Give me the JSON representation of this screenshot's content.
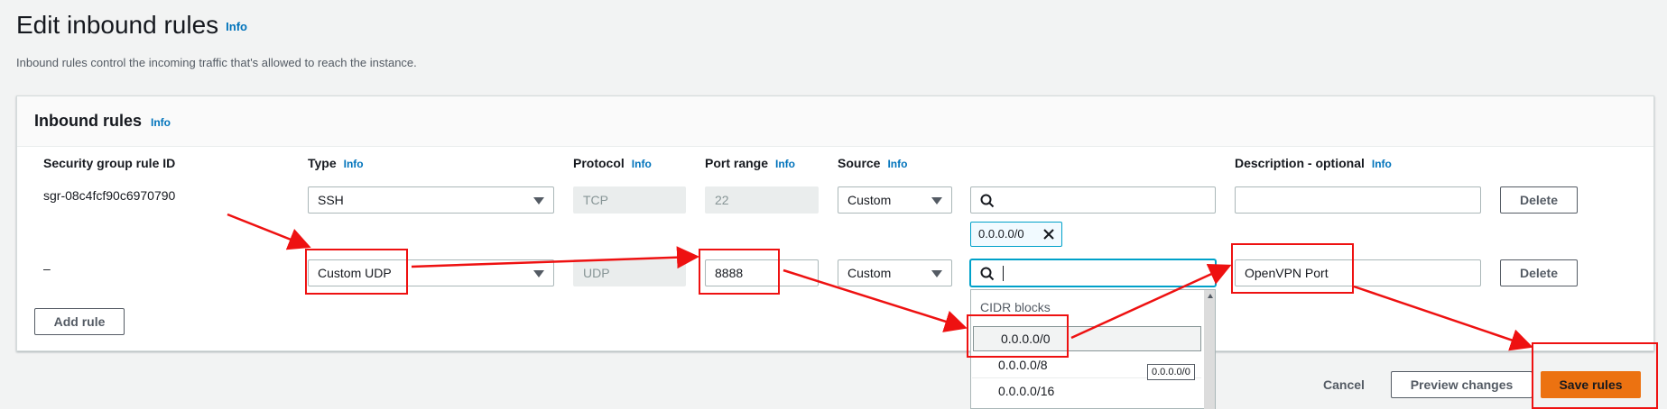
{
  "page": {
    "title": "Edit inbound rules",
    "title_info": "Info",
    "description": "Inbound rules control the incoming traffic that's allowed to reach the instance."
  },
  "panel": {
    "title": "Inbound rules",
    "info": "Info",
    "columns": {
      "rule_id": "Security group rule ID",
      "type": "Type",
      "type_info": "Info",
      "protocol": "Protocol",
      "protocol_info": "Info",
      "port_range": "Port range",
      "port_info": "Info",
      "source": "Source",
      "source_info": "Info",
      "description": "Description - optional",
      "description_info": "Info"
    },
    "rows": [
      {
        "rule_id": "sgr-08c4fcf90c6970790",
        "type": "SSH",
        "protocol": "TCP",
        "port": "22",
        "source": "Custom",
        "source_search": "",
        "token": "0.0.0.0/0",
        "description": "",
        "delete_label": "Delete"
      },
      {
        "rule_id": "–",
        "type": "Custom UDP",
        "protocol": "UDP",
        "port": "8888",
        "source": "Custom",
        "source_search": "",
        "description": "OpenVPN Port",
        "delete_label": "Delete"
      }
    ],
    "add_rule_label": "Add rule"
  },
  "dropdown": {
    "group_label": "CIDR blocks",
    "options": [
      "0.0.0.0/0",
      "0.0.0.0/8",
      "0.0.0.0/16"
    ],
    "tooltip": "0.0.0.0/0"
  },
  "footer": {
    "cancel_label": "Cancel",
    "preview_label": "Preview changes",
    "save_label": "Save rules"
  },
  "colors": {
    "accent": "#0073bb",
    "primary": "#ec7211",
    "annotation": "#ee1111"
  }
}
